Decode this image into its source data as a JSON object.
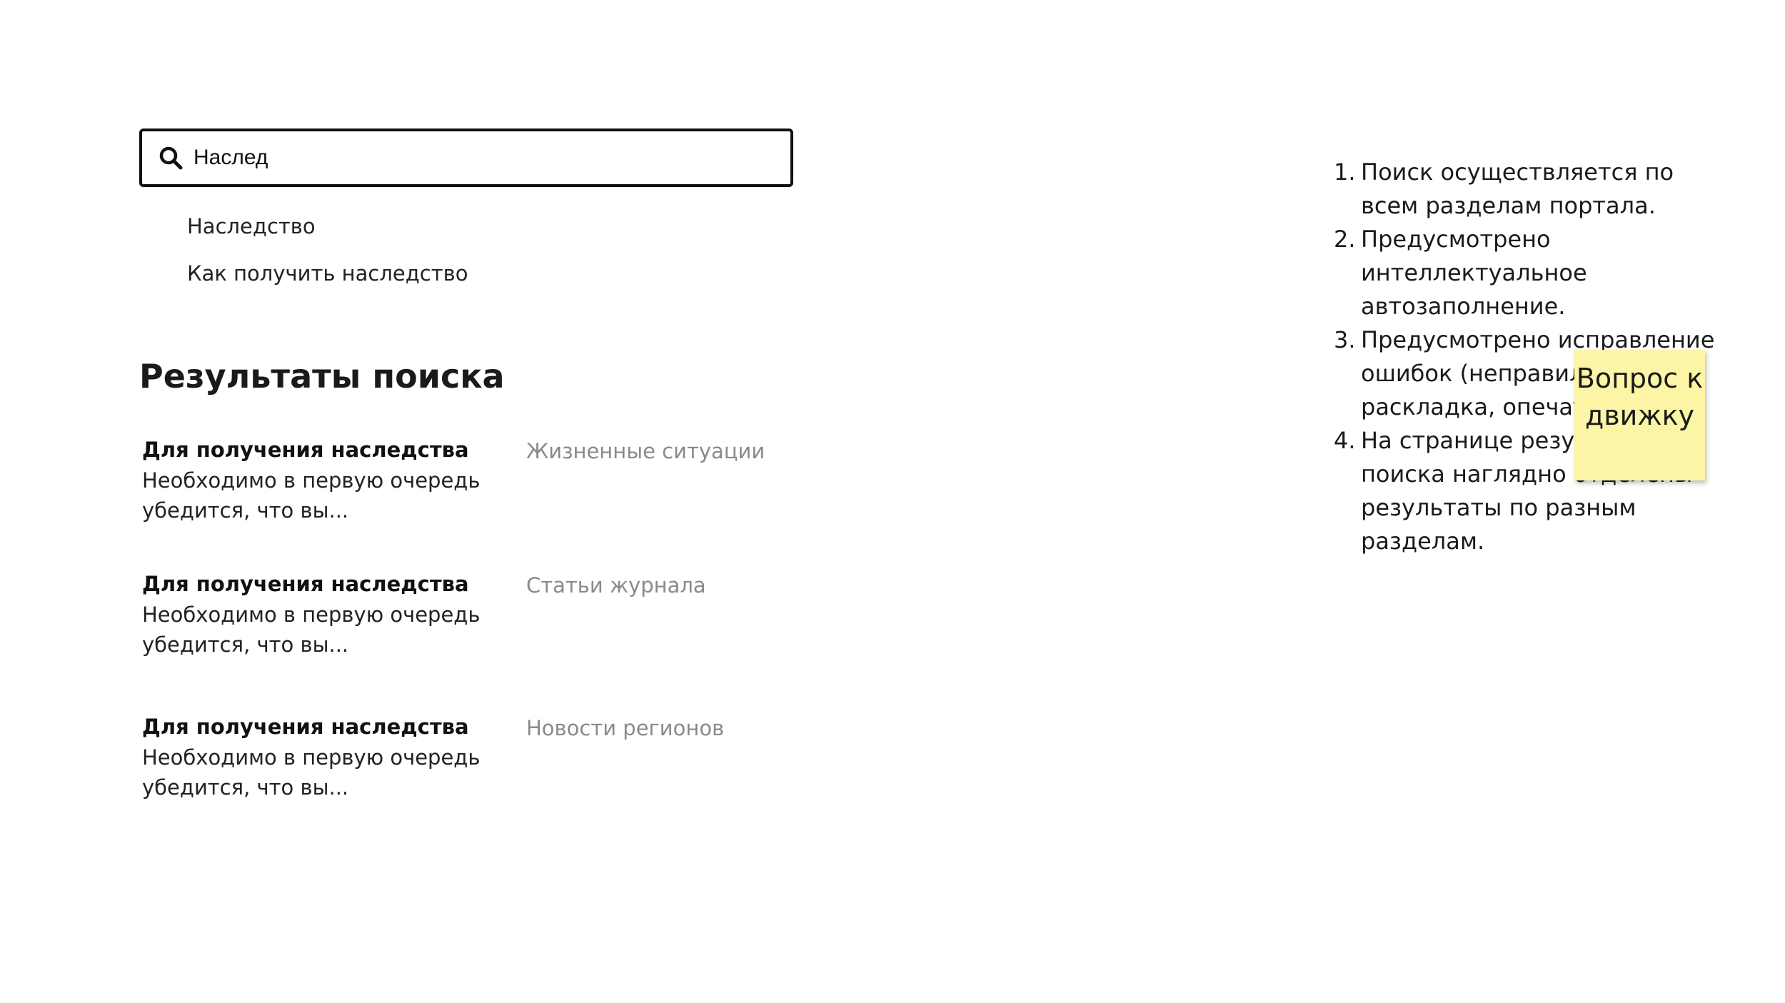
{
  "search": {
    "value": "Наслед",
    "icon": "search-icon"
  },
  "suggestions": [
    "Наследство",
    "Как получить наследство"
  ],
  "results": {
    "heading": "Результаты поиска",
    "items": [
      {
        "title": "Для получения наследства",
        "snippet": "Необходимо в первую очередь убедится, что вы...",
        "category": "Жизненные ситуации"
      },
      {
        "title": "Для получения наследства",
        "snippet": "Необходимо в первую очередь убедится, что вы...",
        "category": "Статьи журнала"
      },
      {
        "title": "Для получения наследства",
        "snippet": "Необходимо в первую очередь убедится, что вы...",
        "category": "Новости регионов"
      }
    ]
  },
  "notes": [
    {
      "num": "1.",
      "text": "Поиск осуществляется по всем разделам портала."
    },
    {
      "num": "2.",
      "text": "Предусмотрено интеллектуальное автозаполнение."
    },
    {
      "num": "3.",
      "text": "Предусмотрено исправление ошибок (неправильная раскладка, опечатки)."
    },
    {
      "num": "4.",
      "text": "На странице результатов поиска наглядно отделены результаты по разным разделам."
    }
  ],
  "sticky_note": {
    "text": "Вопрос к движку",
    "color": "#fdf5a6"
  },
  "colors": {
    "category_text": "#8a8a8a",
    "border": "#111111"
  }
}
